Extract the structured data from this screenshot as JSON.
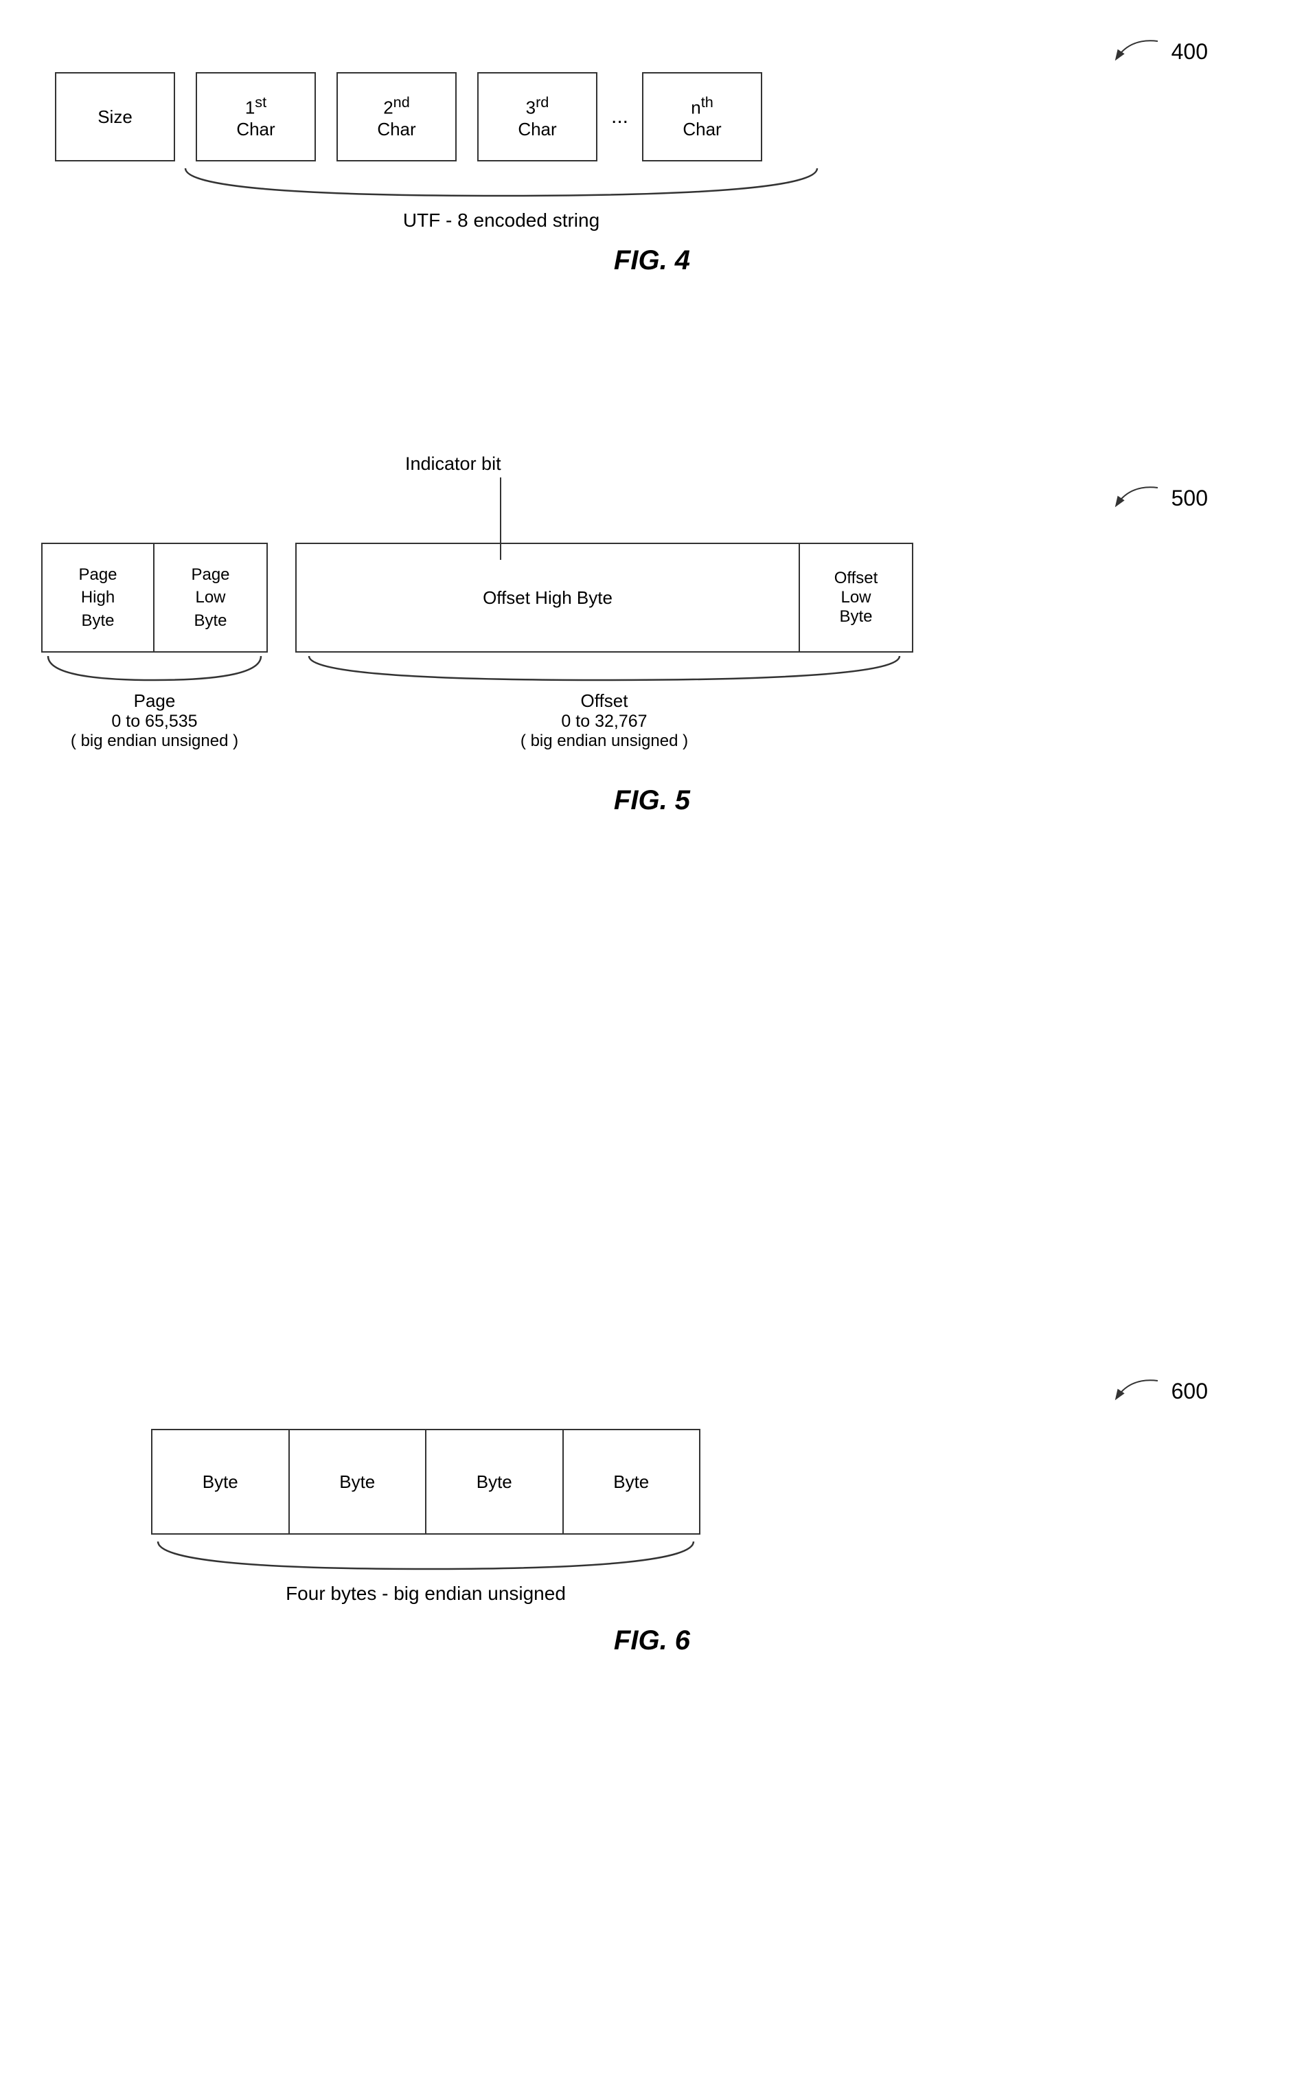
{
  "fig4": {
    "ref_number": "400",
    "boxes": [
      {
        "id": "size",
        "line1": "Size",
        "line2": ""
      },
      {
        "id": "char1",
        "line1": "1",
        "sup": "st",
        "line2": "Char"
      },
      {
        "id": "char2",
        "line1": "2",
        "sup": "nd",
        "line2": "Char"
      },
      {
        "id": "char3",
        "line1": "3",
        "sup": "rd",
        "line2": "Char"
      },
      {
        "id": "charn",
        "line1": "n",
        "sup": "th",
        "line2": "Char"
      }
    ],
    "brace_label": "UTF - 8  encoded string",
    "title": "FIG. 4"
  },
  "fig5": {
    "ref_number": "500",
    "indicator_label": "Indicator bit",
    "left": {
      "box1_label": "Page\nHigh\nByte",
      "box2_label": "Page\nLow\nByte",
      "brace_label1": "Page",
      "brace_label2": "0  to  65,535",
      "brace_label3": "( big endian unsigned )"
    },
    "right": {
      "box_wide_label": "Offset High Byte",
      "box_narrow_label": "Offset\nLow\nByte",
      "brace_label1": "Offset",
      "brace_label2": "0  to  32,767",
      "brace_label3": "( big endian unsigned )"
    },
    "title": "FIG. 5"
  },
  "fig6": {
    "ref_number": "600",
    "boxes": [
      "Byte",
      "Byte",
      "Byte",
      "Byte"
    ],
    "brace_label": "Four bytes  -  big endian unsigned",
    "title": "FIG. 6"
  }
}
